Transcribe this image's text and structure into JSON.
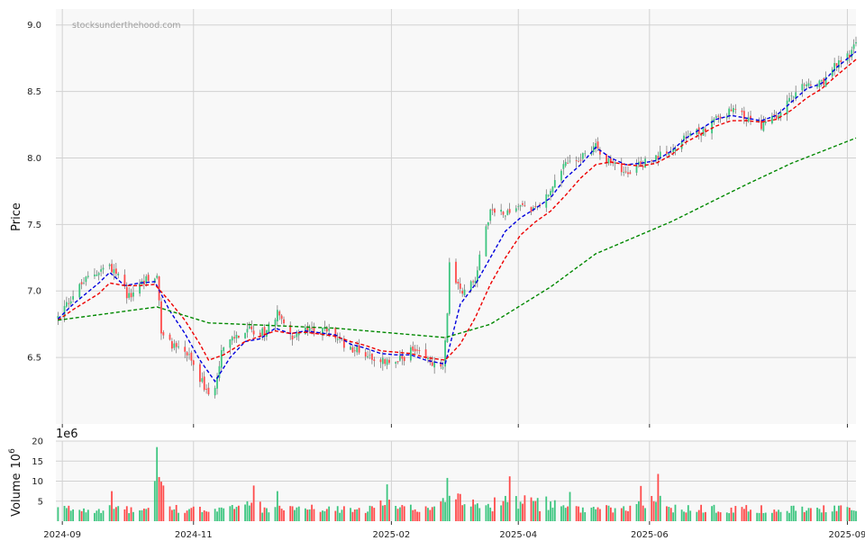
{
  "watermark": "stocksunderthehood.com",
  "chart_data": [
    {
      "type": "candlestick",
      "panel": "price",
      "ylabel": "Price",
      "ylim": [
        6.0,
        9.12
      ],
      "yticks": [
        6.5,
        7.0,
        7.5,
        8.0,
        8.5,
        9.0
      ],
      "ytick_labels": [
        "6.5",
        "7.0",
        "7.5",
        "8.0",
        "8.5",
        "9.0"
      ],
      "x_range": [
        "2024-08-29",
        "2025-09-05"
      ],
      "grid": true,
      "up_color": "#3cc57f",
      "down_color": "#ff4a4a",
      "close_anchors": [
        [
          "2024-08-30",
          6.8
        ],
        [
          "2024-09-05",
          6.95
        ],
        [
          "2024-09-10",
          7.05
        ],
        [
          "2024-09-13",
          7.1
        ],
        [
          "2024-09-18",
          7.15
        ],
        [
          "2024-09-23",
          7.2
        ],
        [
          "2024-09-27",
          7.1
        ],
        [
          "2024-10-02",
          6.95
        ],
        [
          "2024-10-07",
          7.05
        ],
        [
          "2024-10-11",
          7.1
        ],
        [
          "2024-10-15",
          7.1
        ],
        [
          "2024-10-17",
          6.7
        ],
        [
          "2024-10-22",
          6.6
        ],
        [
          "2024-10-28",
          6.55
        ],
        [
          "2024-11-04",
          6.35
        ],
        [
          "2024-11-08",
          6.2
        ],
        [
          "2024-11-11",
          6.3
        ],
        [
          "2024-11-14",
          6.55
        ],
        [
          "2024-11-20",
          6.65
        ],
        [
          "2024-11-27",
          6.7
        ],
        [
          "2024-12-04",
          6.7
        ],
        [
          "2024-12-11",
          6.85
        ],
        [
          "2024-12-16",
          6.65
        ],
        [
          "2024-12-23",
          6.7
        ],
        [
          "2025-01-03",
          6.7
        ],
        [
          "2025-01-10",
          6.6
        ],
        [
          "2025-01-17",
          6.55
        ],
        [
          "2025-01-24",
          6.5
        ],
        [
          "2025-02-03",
          6.45
        ],
        [
          "2025-02-10",
          6.55
        ],
        [
          "2025-02-18",
          6.48
        ],
        [
          "2025-02-25",
          6.4
        ],
        [
          "2025-02-27",
          6.85
        ],
        [
          "2025-02-28",
          7.2
        ],
        [
          "2025-03-05",
          7.0
        ],
        [
          "2025-03-12",
          7.1
        ],
        [
          "2025-03-19",
          7.6
        ],
        [
          "2025-03-26",
          7.6
        ],
        [
          "2025-04-02",
          7.65
        ],
        [
          "2025-04-09",
          7.6
        ],
        [
          "2025-04-16",
          7.75
        ],
        [
          "2025-04-23",
          7.95
        ],
        [
          "2025-04-30",
          8.0
        ],
        [
          "2025-05-07",
          8.1
        ],
        [
          "2025-05-14",
          7.95
        ],
        [
          "2025-05-21",
          7.9
        ],
        [
          "2025-05-28",
          7.95
        ],
        [
          "2025-06-04",
          8.0
        ],
        [
          "2025-06-11",
          8.05
        ],
        [
          "2025-06-18",
          8.15
        ],
        [
          "2025-06-25",
          8.2
        ],
        [
          "2025-07-02",
          8.3
        ],
        [
          "2025-07-09",
          8.35
        ],
        [
          "2025-07-16",
          8.3
        ],
        [
          "2025-07-23",
          8.25
        ],
        [
          "2025-07-30",
          8.3
        ],
        [
          "2025-08-06",
          8.45
        ],
        [
          "2025-08-13",
          8.55
        ],
        [
          "2025-08-20",
          8.55
        ],
        [
          "2025-08-27",
          8.7
        ],
        [
          "2025-09-03",
          8.8
        ],
        [
          "2025-09-05",
          8.85
        ]
      ],
      "moving_averages": [
        {
          "color": "#0000dd",
          "style": "dashed",
          "points": [
            [
              "2024-08-30",
              6.79
            ],
            [
              "2024-09-06",
              6.9
            ],
            [
              "2024-09-12",
              6.98
            ],
            [
              "2024-09-18",
              7.06
            ],
            [
              "2024-09-23",
              7.14
            ],
            [
              "2024-09-30",
              7.04
            ],
            [
              "2024-10-07",
              7.06
            ],
            [
              "2024-10-14",
              7.07
            ],
            [
              "2024-10-21",
              6.85
            ],
            [
              "2024-10-28",
              6.68
            ],
            [
              "2024-11-04",
              6.48
            ],
            [
              "2024-11-11",
              6.32
            ],
            [
              "2024-11-18",
              6.5
            ],
            [
              "2024-11-25",
              6.62
            ],
            [
              "2024-12-02",
              6.64
            ],
            [
              "2024-12-09",
              6.72
            ],
            [
              "2024-12-16",
              6.68
            ],
            [
              "2024-12-23",
              6.7
            ],
            [
              "2025-01-06",
              6.67
            ],
            [
              "2025-01-13",
              6.6
            ],
            [
              "2025-01-20",
              6.57
            ],
            [
              "2025-01-27",
              6.53
            ],
            [
              "2025-02-03",
              6.52
            ],
            [
              "2025-02-10",
              6.52
            ],
            [
              "2025-02-17",
              6.48
            ],
            [
              "2025-02-26",
              6.45
            ],
            [
              "2025-03-05",
              6.9
            ],
            [
              "2025-03-12",
              7.05
            ],
            [
              "2025-03-19",
              7.25
            ],
            [
              "2025-03-26",
              7.45
            ],
            [
              "2025-04-02",
              7.55
            ],
            [
              "2025-04-09",
              7.62
            ],
            [
              "2025-04-16",
              7.7
            ],
            [
              "2025-04-23",
              7.85
            ],
            [
              "2025-04-30",
              7.95
            ],
            [
              "2025-05-07",
              8.08
            ],
            [
              "2025-05-14",
              8.0
            ],
            [
              "2025-05-21",
              7.95
            ],
            [
              "2025-05-28",
              7.96
            ],
            [
              "2025-06-04",
              7.98
            ],
            [
              "2025-06-11",
              8.05
            ],
            [
              "2025-06-18",
              8.15
            ],
            [
              "2025-06-25",
              8.22
            ],
            [
              "2025-07-02",
              8.29
            ],
            [
              "2025-07-09",
              8.32
            ],
            [
              "2025-07-16",
              8.3
            ],
            [
              "2025-07-23",
              8.28
            ],
            [
              "2025-07-30",
              8.32
            ],
            [
              "2025-08-06",
              8.42
            ],
            [
              "2025-08-13",
              8.52
            ],
            [
              "2025-08-20",
              8.56
            ],
            [
              "2025-08-27",
              8.68
            ],
            [
              "2025-09-05",
              8.8
            ]
          ]
        },
        {
          "color": "#ee0000",
          "style": "dashed",
          "points": [
            [
              "2024-08-30",
              6.78
            ],
            [
              "2024-09-06",
              6.86
            ],
            [
              "2024-09-12",
              6.92
            ],
            [
              "2024-09-18",
              6.98
            ],
            [
              "2024-09-23",
              7.06
            ],
            [
              "2024-09-30",
              7.04
            ],
            [
              "2024-10-07",
              7.04
            ],
            [
              "2024-10-14",
              7.05
            ],
            [
              "2024-10-21",
              6.92
            ],
            [
              "2024-10-28",
              6.78
            ],
            [
              "2024-11-04",
              6.6
            ],
            [
              "2024-11-08",
              6.48
            ],
            [
              "2024-11-15",
              6.52
            ],
            [
              "2024-11-25",
              6.62
            ],
            [
              "2024-12-02",
              6.66
            ],
            [
              "2024-12-09",
              6.7
            ],
            [
              "2024-12-16",
              6.68
            ],
            [
              "2024-12-23",
              6.69
            ],
            [
              "2025-01-06",
              6.66
            ],
            [
              "2025-01-13",
              6.62
            ],
            [
              "2025-01-20",
              6.59
            ],
            [
              "2025-01-27",
              6.55
            ],
            [
              "2025-02-03",
              6.54
            ],
            [
              "2025-02-10",
              6.53
            ],
            [
              "2025-02-17",
              6.5
            ],
            [
              "2025-02-26",
              6.48
            ],
            [
              "2025-03-05",
              6.6
            ],
            [
              "2025-03-12",
              6.8
            ],
            [
              "2025-03-19",
              7.05
            ],
            [
              "2025-03-26",
              7.25
            ],
            [
              "2025-04-02",
              7.42
            ],
            [
              "2025-04-09",
              7.52
            ],
            [
              "2025-04-16",
              7.6
            ],
            [
              "2025-04-23",
              7.72
            ],
            [
              "2025-04-30",
              7.85
            ],
            [
              "2025-05-07",
              7.95
            ],
            [
              "2025-05-14",
              7.97
            ],
            [
              "2025-05-21",
              7.95
            ],
            [
              "2025-05-28",
              7.94
            ],
            [
              "2025-06-04",
              7.96
            ],
            [
              "2025-06-11",
              8.02
            ],
            [
              "2025-06-18",
              8.12
            ],
            [
              "2025-06-25",
              8.18
            ],
            [
              "2025-07-02",
              8.24
            ],
            [
              "2025-07-09",
              8.28
            ],
            [
              "2025-07-16",
              8.28
            ],
            [
              "2025-07-23",
              8.27
            ],
            [
              "2025-07-30",
              8.29
            ],
            [
              "2025-08-06",
              8.36
            ],
            [
              "2025-08-13",
              8.45
            ],
            [
              "2025-08-20",
              8.52
            ],
            [
              "2025-08-27",
              8.62
            ],
            [
              "2025-09-05",
              8.74
            ]
          ]
        },
        {
          "color": "#008800",
          "style": "dashed",
          "points": [
            [
              "2024-08-30",
              6.78
            ],
            [
              "2024-10-15",
              6.88
            ],
            [
              "2024-11-08",
              6.76
            ],
            [
              "2025-01-06",
              6.72
            ],
            [
              "2025-02-26",
              6.65
            ],
            [
              "2025-03-19",
              6.75
            ],
            [
              "2025-04-16",
              7.03
            ],
            [
              "2025-05-07",
              7.28
            ],
            [
              "2025-06-11",
              7.52
            ],
            [
              "2025-07-16",
              7.8
            ],
            [
              "2025-08-06",
              7.96
            ],
            [
              "2025-09-05",
              8.15
            ]
          ]
        }
      ]
    },
    {
      "type": "bar",
      "panel": "volume",
      "ylabel_main": "Volume",
      "ylabel_unit_base": "10",
      "ylabel_unit_exp": "6",
      "offset_text": "1e6",
      "ylim": [
        0,
        20
      ],
      "yticks": [
        5,
        10,
        15,
        20
      ],
      "ytick_labels": [
        "5",
        "10",
        "15",
        "20"
      ],
      "spikes": [
        [
          "2024-10-15",
          18.5
        ],
        [
          "2024-11-29",
          8.9
        ],
        [
          "2024-12-10",
          7.5
        ],
        [
          "2025-01-30",
          9.2
        ],
        [
          "2025-02-27",
          10.8
        ],
        [
          "2025-03-28",
          11.2
        ],
        [
          "2025-04-25",
          7.3
        ],
        [
          "2025-05-28",
          8.8
        ],
        [
          "2025-06-05",
          11.8
        ],
        [
          "2024-09-24",
          7.5
        ]
      ],
      "x_ticks": [
        "2024-09-01",
        "2024-11-01",
        "2025-02-01",
        "2025-04-01",
        "2025-06-01",
        "2025-09-01"
      ],
      "x_tick_labels": [
        "2024-09",
        "2024-11",
        "2025-02",
        "2025-04",
        "2025-06",
        "2025-09"
      ]
    }
  ]
}
